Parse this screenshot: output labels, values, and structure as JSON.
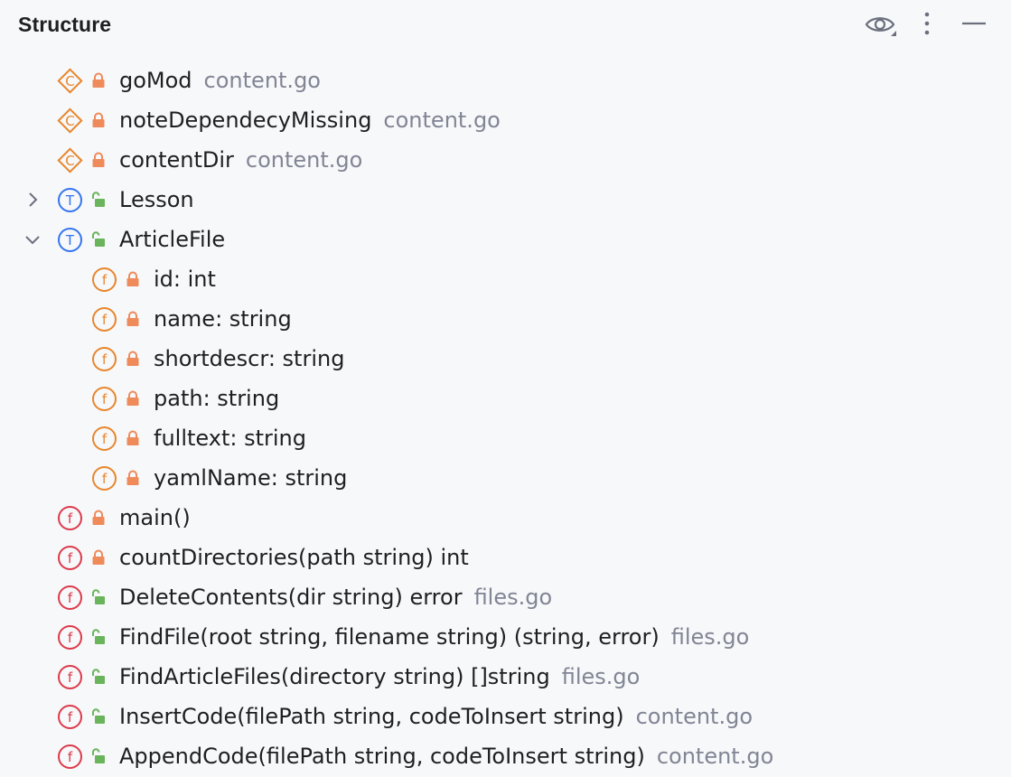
{
  "panel": {
    "title": "Structure"
  },
  "colors": {
    "background": "#f7f8fa",
    "constant_icon": "#e8862d",
    "type_icon": "#3574f0",
    "field_icon": "#e8862d",
    "function_icon": "#db3b4b",
    "lock_private": "#ef8a5a",
    "lock_public": "#6ab45b",
    "secondary_text": "#818594"
  },
  "tree": [
    {
      "name": "goMod",
      "file": "content.go",
      "icon": "constant-icon",
      "access": "private",
      "depth": 0,
      "expander": "none"
    },
    {
      "name": "noteDependecyMissing",
      "file": "content.go",
      "icon": "constant-icon",
      "access": "private",
      "depth": 0,
      "expander": "none"
    },
    {
      "name": "contentDir",
      "file": "content.go",
      "icon": "constant-icon",
      "access": "private",
      "depth": 0,
      "expander": "none"
    },
    {
      "name": "Lesson",
      "file": "",
      "icon": "type-icon",
      "access": "public",
      "depth": 0,
      "expander": "collapsed"
    },
    {
      "name": "ArticleFile",
      "file": "",
      "icon": "type-icon",
      "access": "public",
      "depth": 0,
      "expander": "expanded"
    },
    {
      "name": "id: int",
      "file": "",
      "icon": "field-icon",
      "access": "private",
      "depth": 1,
      "expander": "none"
    },
    {
      "name": "name: string",
      "file": "",
      "icon": "field-icon",
      "access": "private",
      "depth": 1,
      "expander": "none"
    },
    {
      "name": "shortdescr: string",
      "file": "",
      "icon": "field-icon",
      "access": "private",
      "depth": 1,
      "expander": "none"
    },
    {
      "name": "path: string",
      "file": "",
      "icon": "field-icon",
      "access": "private",
      "depth": 1,
      "expander": "none"
    },
    {
      "name": "fulltext: string",
      "file": "",
      "icon": "field-icon",
      "access": "private",
      "depth": 1,
      "expander": "none"
    },
    {
      "name": "yamlName: string",
      "file": "",
      "icon": "field-icon",
      "access": "private",
      "depth": 1,
      "expander": "none"
    },
    {
      "name": "main()",
      "file": "",
      "icon": "function-icon",
      "access": "private",
      "depth": 0,
      "expander": "none"
    },
    {
      "name": "countDirectories(path string) int",
      "file": "",
      "icon": "function-icon",
      "access": "private",
      "depth": 0,
      "expander": "none"
    },
    {
      "name": "DeleteContents(dir string) error",
      "file": "files.go",
      "icon": "function-icon",
      "access": "public",
      "depth": 0,
      "expander": "none"
    },
    {
      "name": "FindFile(root string, filename string) (string, error)",
      "file": "files.go",
      "icon": "function-icon",
      "access": "public",
      "depth": 0,
      "expander": "none"
    },
    {
      "name": "FindArticleFiles(directory string) []string",
      "file": "files.go",
      "icon": "function-icon",
      "access": "public",
      "depth": 0,
      "expander": "none"
    },
    {
      "name": "InsertCode(filePath string, codeToInsert string)",
      "file": "content.go",
      "icon": "function-icon",
      "access": "public",
      "depth": 0,
      "expander": "none"
    },
    {
      "name": "AppendCode(filePath string, codeToInsert string)",
      "file": "content.go",
      "icon": "function-icon",
      "access": "public",
      "depth": 0,
      "expander": "none"
    }
  ]
}
